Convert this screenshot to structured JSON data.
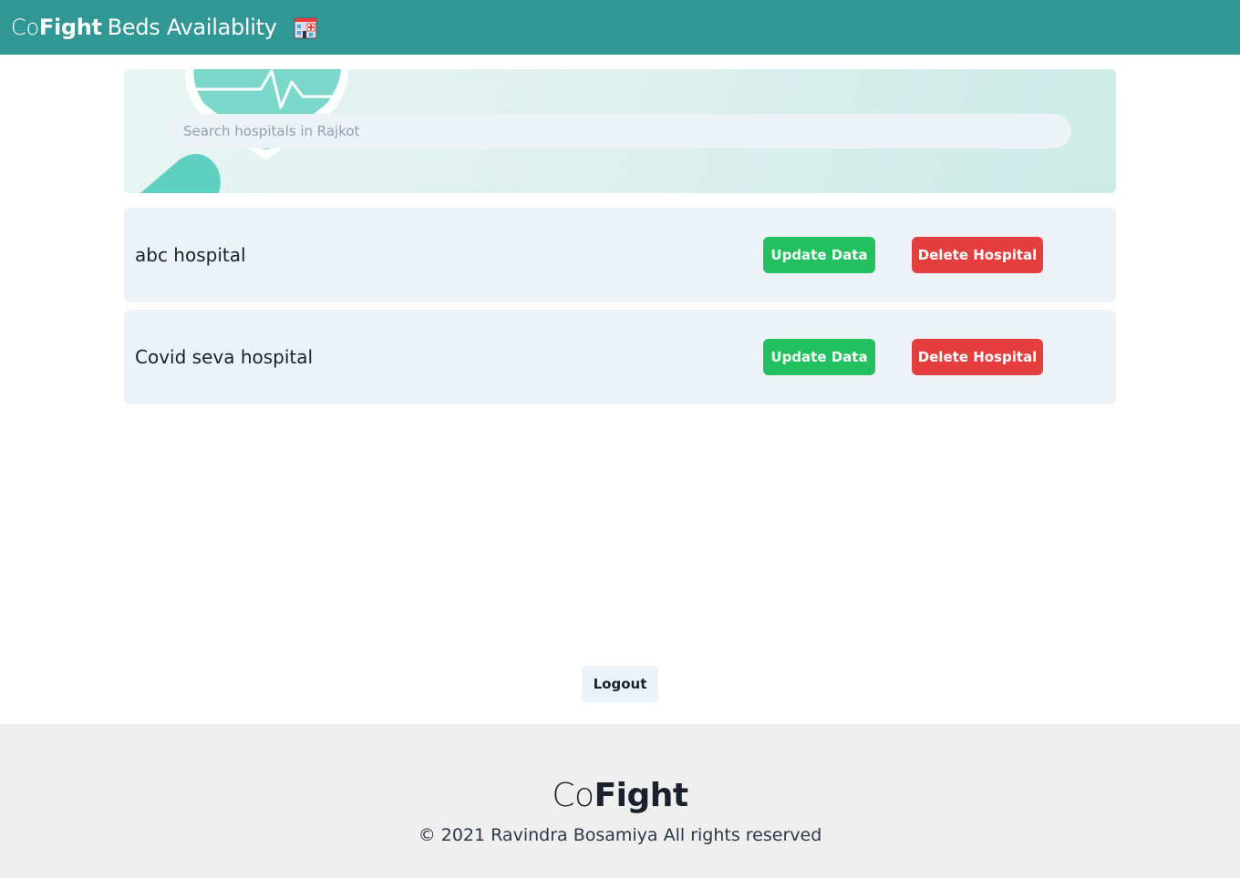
{
  "header": {
    "brand_prefix": "Co",
    "brand_bold": "Fight",
    "brand_suffix": "Beds Availablity",
    "icon": "hospital-icon"
  },
  "search": {
    "placeholder": "Search hospitals in Rajkot",
    "value": ""
  },
  "hospitals": [
    {
      "name": "abc hospital",
      "update_label": "Update Data",
      "delete_label": "Delete Hospital"
    },
    {
      "name": "Covid seva hospital",
      "update_label": "Update Data",
      "delete_label": "Delete Hospital"
    }
  ],
  "actions": {
    "logout_label": "Logout"
  },
  "footer": {
    "brand_prefix": "Co",
    "brand_bold": "Fight",
    "copyright": "© 2021 Ravindra Bosamiya All rights reserved"
  },
  "colors": {
    "header_bg": "#319795",
    "update_button": "#22c05e",
    "delete_button": "#e53e3e",
    "row_bg": "#edf2f7",
    "footer_bg": "#efefef"
  }
}
